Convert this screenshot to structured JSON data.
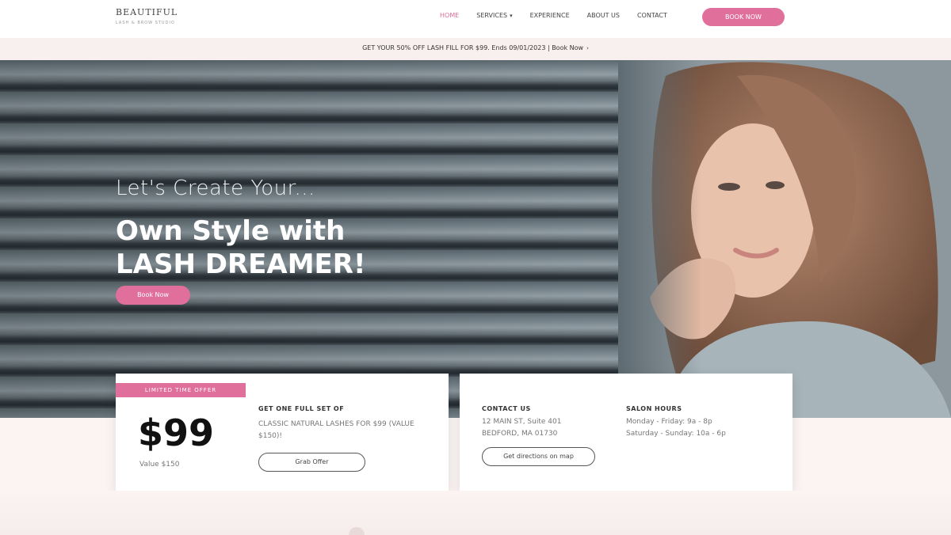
{
  "header": {
    "logo_text": "BEAUTIFUL",
    "logo_tagline": "LASH & BROW STUDIO",
    "nav": [
      {
        "label": "HOME",
        "active": true
      },
      {
        "label": "SERVICES",
        "dropdown": true
      },
      {
        "label": "EXPERIENCE"
      },
      {
        "label": "ABOUT US"
      },
      {
        "label": "CONTACT"
      }
    ],
    "cta_label": "BOOK NOW"
  },
  "promo": {
    "text": "GET YOUR 50% OFF LASH FILL FOR $99. Ends 09/01/2023 | Book Now",
    "icon": "chevron-right-icon"
  },
  "hero": {
    "subtitle": "Let's Create Your...",
    "title_line1": "Own Style with",
    "title_line2": "LASH DREAMER!",
    "button_label": "Book Now"
  },
  "offer": {
    "ribbon": "LIMITED TIME OFFER",
    "price": "$99",
    "price_note": "Value $150",
    "heading": "GET ONE FULL SET OF",
    "description": "CLASSIC NATURAL LASHES FOR $99 (VALUE $150)!",
    "button_label": "Grab Offer"
  },
  "contact": {
    "heading": "CONTACT US",
    "address_line1": "12 MAIN ST, Suite 401",
    "address_line2": "BEDFORD, MA 01730",
    "button_label": "Get directions on map",
    "hours_heading": "SALON HOURS",
    "hours_line1": "Monday - Friday: 9a - 8p",
    "hours_line2": "Saturday - Sunday: 10a - 6p"
  },
  "colors": {
    "accent": "#e0709b",
    "hero_dark": "#2f383e",
    "page_bg": "#fbf4f3"
  }
}
